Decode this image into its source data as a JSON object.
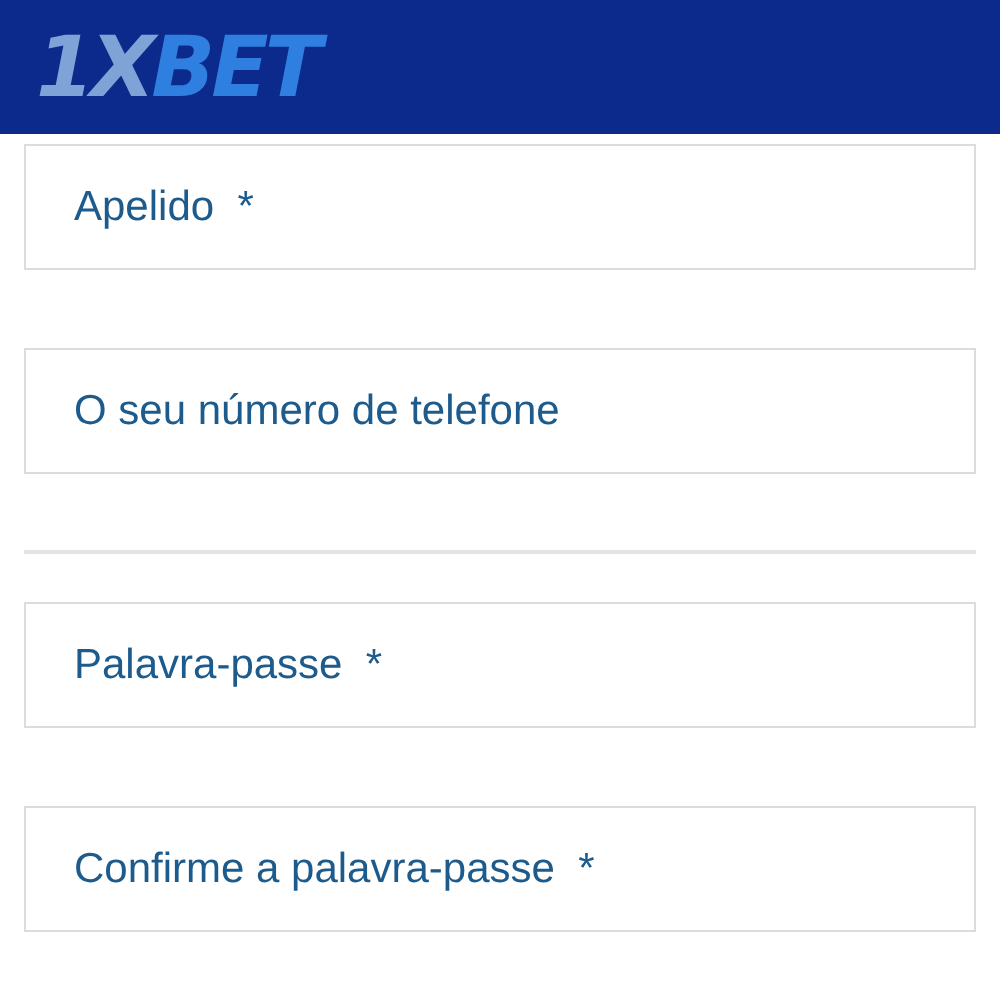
{
  "header": {
    "logo": {
      "prefix": "1X",
      "suffix": "BET"
    }
  },
  "form": [
    {
      "kind": "field",
      "placeholder": "Apelido  *"
    },
    {
      "kind": "field",
      "placeholder": "O seu número de telefone"
    },
    {
      "kind": "divider"
    },
    {
      "kind": "field",
      "placeholder": "Palavra-passe  *"
    },
    {
      "kind": "field",
      "placeholder": "Confirme a palavra-passe  *"
    }
  ]
}
